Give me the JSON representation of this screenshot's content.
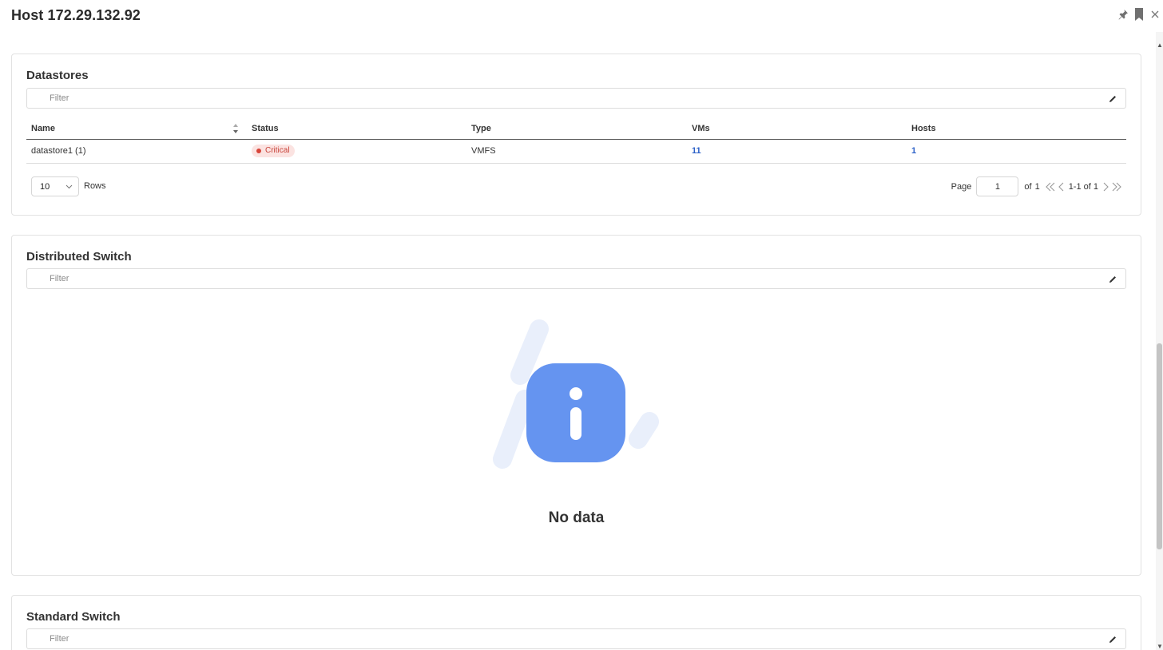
{
  "header": {
    "title": "Host 172.29.132.92",
    "icons": [
      "pin-icon",
      "bookmark-icon",
      "close-icon"
    ]
  },
  "datastores": {
    "title": "Datastores",
    "filter_placeholder": "Filter",
    "columns": [
      "Name",
      "Status",
      "Type",
      "VMs",
      "Hosts"
    ],
    "rows": [
      {
        "name": "datastore1 (1)",
        "status": "Critical",
        "type": "VMFS",
        "vms": "11",
        "hosts": "1"
      }
    ],
    "rows_per_page": "10",
    "rows_label": "Rows",
    "pager": {
      "page_label": "Page",
      "page_value": "1",
      "of_label": "of",
      "total_pages": "1",
      "range": "1-1 of 1"
    }
  },
  "distributed_switch": {
    "title": "Distributed Switch",
    "filter_placeholder": "Filter",
    "empty_text": "No data"
  },
  "standard_switch": {
    "title": "Standard Switch",
    "filter_placeholder": "Filter"
  },
  "colors": {
    "critical_text": "#c9443b",
    "critical_bg": "#fbe3e1",
    "link": "#2d62c8",
    "info_icon": "#6594f0"
  }
}
